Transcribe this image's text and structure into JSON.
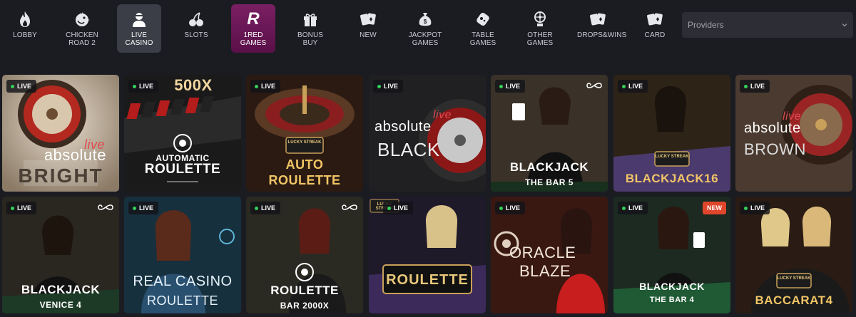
{
  "nav": {
    "items": [
      {
        "label": "LOBBY",
        "icon": "flame-icon"
      },
      {
        "label": "CHICKEN ROAD 2",
        "icon": "chicken-icon"
      },
      {
        "label": "LIVE CASINO",
        "icon": "dealer-icon"
      },
      {
        "label": "SLOTS",
        "icon": "cherries-icon"
      },
      {
        "label": "1RED GAMES",
        "icon": "brand-r-icon"
      },
      {
        "label": "BONUS BUY",
        "icon": "gift-icon"
      },
      {
        "label": "NEW",
        "icon": "cards-icon"
      },
      {
        "label": "JACKPOT GAMES",
        "icon": "money-bag-icon"
      },
      {
        "label": "TABLE GAMES",
        "icon": "joystick-icon"
      },
      {
        "label": "OTHER GAMES",
        "icon": "wheel-icon"
      },
      {
        "label": "DROPS&WINS",
        "icon": "cards-icon"
      },
      {
        "label": "CARD",
        "icon": "cards-icon"
      }
    ],
    "brand_letter": "R"
  },
  "providers": {
    "placeholder": "Providers"
  },
  "badges": {
    "live": "LIVE",
    "new": "NEW"
  },
  "tiles": [
    {
      "title_a": "absolute",
      "title_b": "BRIGHT",
      "tag": "live"
    },
    {
      "title_top": "500X",
      "title_a": "AUTOMATIC",
      "title_b": "ROULETTE"
    },
    {
      "logo": "LUCKY STREAK",
      "title_a": "AUTO",
      "title_b": "ROULETTE"
    },
    {
      "title_a": "absolute",
      "title_b": "BLACK",
      "tag": "live"
    },
    {
      "title_a": "BLACKJACK",
      "title_b": "THE BAR 5"
    },
    {
      "logo": "LUCKY STREAK",
      "title_a": "BLACKJACK16"
    },
    {
      "title_a": "absolute",
      "title_b": "BROWN",
      "tag": "live"
    },
    {
      "title_a": "BLACKJACK",
      "title_b": "VENICE 4"
    },
    {
      "title_a": "REAL CASINO",
      "title_b": "ROULETTE"
    },
    {
      "title_a": "ROULETTE",
      "title_b": "BAR 2000X"
    },
    {
      "logo": "LUCKY STREAK",
      "title_a": "ROULETTE"
    },
    {
      "title_a": "ORACLE",
      "title_b": "BLAZE"
    },
    {
      "title_a": "BLACKJACK",
      "title_b": "THE BAR 4"
    },
    {
      "logo": "LUCKY STREAK",
      "title_a": "BACCARAT4"
    }
  ],
  "colors": {
    "accent_live": "#34d058",
    "brand": "#7a1f63",
    "new_badge": "#e0462c"
  }
}
